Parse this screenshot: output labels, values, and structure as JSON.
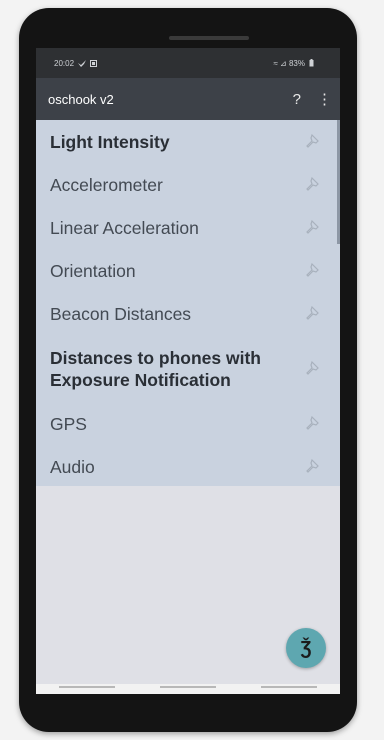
{
  "status_bar": {
    "time": "20:02",
    "notif_icons": [
      "bird-icon",
      "image-icon"
    ],
    "signal_text": "≈ ⊿ 83%",
    "battery_icon": "battery-icon"
  },
  "app_bar": {
    "title": "oschook v2",
    "help_label": "?",
    "menu_label": "⋮"
  },
  "sensors": [
    {
      "label": "Light Intensity",
      "bold": true
    },
    {
      "label": "Accelerometer",
      "bold": false
    },
    {
      "label": "Linear Acceleration",
      "bold": false
    },
    {
      "label": "Orientation",
      "bold": false
    },
    {
      "label": "Beacon Distances",
      "bold": false
    },
    {
      "label": "Distances to phones with Exposure Notification",
      "bold": true
    },
    {
      "label": "GPS",
      "bold": false
    },
    {
      "label": "Audio",
      "bold": false
    }
  ],
  "fab": {
    "icon": "hook-icon",
    "label": "Ǯ"
  },
  "colors": {
    "status_bar": "#2e3033",
    "app_bar": "#3d4148",
    "list_bg": "#c9d2df",
    "screen_bg": "#dfe0e6",
    "fab": "#5ea7b0"
  }
}
